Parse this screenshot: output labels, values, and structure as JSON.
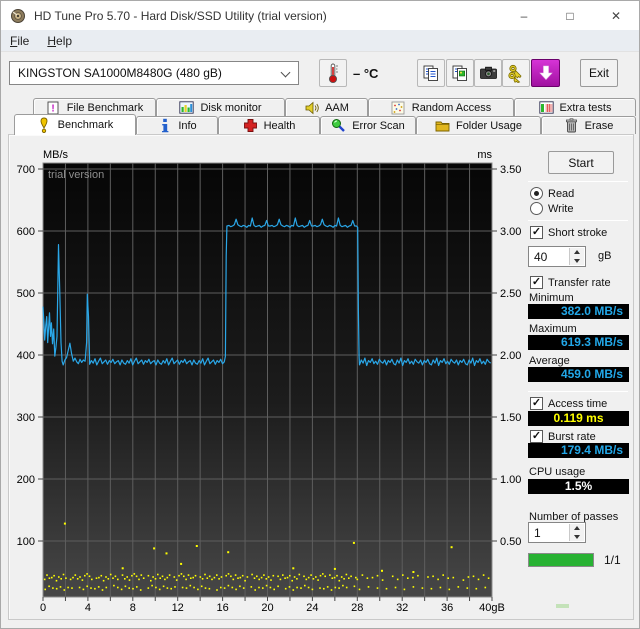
{
  "window": {
    "title": "HD Tune Pro 5.70 - Hard Disk/SSD Utility (trial version)",
    "caption": {
      "minimize": "–",
      "maximize": "□",
      "close": "✕"
    }
  },
  "menu": {
    "items": [
      "File",
      "Help"
    ]
  },
  "toolbar": {
    "drive_select": "KINGSTON SA1000M8480G (480 gB)",
    "temperature": "– °C",
    "exit_label": "Exit"
  },
  "tabs": {
    "row1": [
      "File Benchmark",
      "Disk monitor",
      "AAM",
      "Random Access",
      "Extra tests"
    ],
    "row2": [
      "Benchmark",
      "Info",
      "Health",
      "Error Scan",
      "Folder Usage",
      "Erase"
    ],
    "active": "Benchmark"
  },
  "panel": {
    "start_label": "Start",
    "read_label": "Read",
    "write_label": "Write",
    "short_stroke_label": "Short stroke",
    "short_stroke_value": "40",
    "short_stroke_unit": "gB",
    "transfer_rate_label": "Transfer rate",
    "minimum_label": "Minimum",
    "minimum_value": "382.0 MB/s",
    "maximum_label": "Maximum",
    "maximum_value": "619.3 MB/s",
    "average_label": "Average",
    "average_value": "459.0 MB/s",
    "access_time_label": "Access time",
    "access_time_value": "0.119 ms",
    "burst_rate_label": "Burst rate",
    "burst_rate_value": "179.4 MB/s",
    "cpu_usage_label": "CPU usage",
    "cpu_usage_value": "1.5%",
    "passes_label": "Number of passes",
    "passes_value": "1",
    "progress_text": "1/1"
  },
  "chart_data": {
    "type": "line",
    "watermark": "trial version",
    "grid": true,
    "left_axis": {
      "unit": "MB/s",
      "ticks": [
        700,
        600,
        500,
        400,
        300,
        200,
        100
      ],
      "range": [
        0,
        710
      ]
    },
    "right_axis": {
      "unit": "ms",
      "ticks": [
        "3.50",
        "3.00",
        "2.50",
        "2.00",
        "1.50",
        "1.00",
        "0.50"
      ],
      "range": [
        0,
        3.55
      ]
    },
    "x_axis": {
      "tick_labels": [
        "0",
        "4",
        "8",
        "12",
        "16",
        "20",
        "24",
        "28",
        "32",
        "36",
        "40gB"
      ],
      "tick_values": [
        0,
        4,
        8,
        12,
        16,
        20,
        24,
        28,
        32,
        36,
        40
      ],
      "range": [
        0,
        40
      ],
      "grid_step": 2
    },
    "series": [
      {
        "name": "transfer-rate",
        "color": "#2aa7e8",
        "segments": [
          {
            "pts": [
              [
                0,
                478
              ],
              [
                0.08,
                452
              ],
              [
                0.15,
                424
              ],
              [
                0.25,
                448
              ],
              [
                0.33,
                462
              ],
              [
                0.42,
                420
              ],
              [
                0.5,
                444
              ],
              [
                0.58,
                468
              ],
              [
                0.67,
                430
              ],
              [
                0.75,
                452
              ],
              [
                0.85,
                418
              ],
              [
                0.95,
                442
              ],
              [
                1.05,
                398
              ],
              [
                1.15,
                412
              ],
              [
                1.25,
                430
              ],
              [
                1.38,
                578
              ],
              [
                1.5,
                500
              ],
              [
                1.6,
                420
              ],
              [
                1.7,
                390
              ],
              [
                1.8,
                384
              ],
              [
                1.95,
                392
              ],
              [
                2.1,
                396
              ],
              [
                2.25,
                408
              ],
              [
                2.4,
                419
              ],
              [
                2.55,
                402
              ],
              [
                2.7,
                390
              ],
              [
                2.85,
                395
              ],
              [
                3.0,
                389
              ],
              [
                3.15,
                386
              ],
              [
                3.3,
                393
              ],
              [
                3.45,
                388
              ],
              [
                3.6,
                392
              ],
              [
                3.75,
                390
              ],
              [
                3.88,
                420
              ],
              [
                3.95,
                498
              ],
              [
                4.05,
                462
              ],
              [
                4.15,
                392
              ]
            ]
          },
          {
            "range": [
              4.15,
              16.15
            ],
            "step": 0.16,
            "base": 389,
            "pattern": [
              -4,
              2,
              -2,
              5,
              -5,
              1,
              6,
              -3,
              0,
              3,
              -4,
              2,
              -1,
              4,
              -3,
              0,
              2,
              -5,
              3,
              -2
            ]
          },
          {
            "pts": [
              [
                16.25,
                398
              ],
              [
                16.32,
                560
              ],
              [
                16.38,
                608
              ]
            ]
          },
          {
            "range": [
              16.4,
              28.0
            ],
            "step": 0.16,
            "base": 608,
            "pattern": [
              0,
              1,
              -1,
              0,
              2,
              11,
              2,
              0,
              -1,
              1,
              0,
              -2,
              1,
              0,
              13,
              1,
              -1,
              0,
              1,
              -2,
              0,
              1,
              9,
              0
            ]
          },
          {
            "pts": [
              [
                28.04,
                606
              ],
              [
                28.1,
                470
              ],
              [
                28.16,
                396
              ]
            ]
          },
          {
            "range": [
              28.2,
              40
            ],
            "step": 0.16,
            "base": 389,
            "pattern": [
              -5,
              3,
              -2,
              6,
              -6,
              2,
              -1,
              5,
              -3,
              1,
              -4,
              4,
              0,
              -2,
              3,
              -5,
              2,
              -1,
              4,
              -3
            ]
          }
        ]
      },
      {
        "name": "access-time",
        "color": "#ffff00",
        "bands": [
          {
            "range": [
              0.15,
              27.9
            ],
            "step": 0.21,
            "y": 41,
            "jitter": [
              2,
              -3,
              4,
              -1,
              0,
              3,
              -5,
              1,
              -2,
              5,
              -1,
              2,
              -3,
              0,
              4,
              -2,
              1,
              -4,
              3,
              6
            ],
            "gap_every": 11
          },
          {
            "range": [
              28.0,
              39.8
            ],
            "step": 0.45,
            "y": 41,
            "jitter": [
              2,
              -3,
              4,
              -1,
              0,
              3,
              -4,
              1
            ],
            "gap_every": 7
          },
          {
            "range": [
              0.2,
              27.8
            ],
            "step": 0.34,
            "y": 24,
            "jitter": [
              1,
              -2,
              3,
              0,
              -1,
              2,
              -3,
              1,
              0,
              4
            ],
            "gap_every": 9
          },
          {
            "range": [
              28.2,
              39.5
            ],
            "step": 0.8,
            "y": 24,
            "jitter": [
              1,
              -2,
              2,
              0,
              -1
            ],
            "gap_every": 0
          }
        ],
        "outliers": [
          [
            1.95,
            128
          ],
          [
            7.1,
            56
          ],
          [
            9.9,
            88
          ],
          [
            11.0,
            80
          ],
          [
            12.3,
            63
          ],
          [
            13.7,
            92
          ],
          [
            16.5,
            82
          ],
          [
            22.3,
            56
          ],
          [
            26.0,
            55
          ],
          [
            27.7,
            97
          ],
          [
            30.2,
            52
          ],
          [
            33.0,
            50
          ],
          [
            36.4,
            90
          ]
        ]
      }
    ],
    "summary": {
      "minimum": "382.0 MB/s",
      "maximum": "619.3 MB/s",
      "average": "459.0 MB/s",
      "access_time": "0.119 ms",
      "burst_rate": "179.4 MB/s",
      "cpu_usage": "1.5%"
    }
  }
}
